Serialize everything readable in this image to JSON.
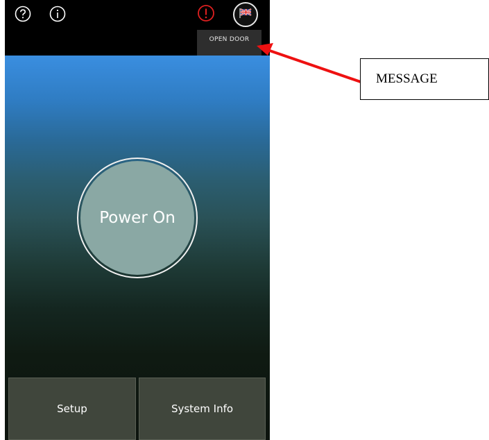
{
  "statusbar": {
    "icons": [
      "help-icon",
      "info-icon",
      "alert-icon",
      "uk-flag-icon"
    ],
    "alert_color": "#e02020"
  },
  "popup": {
    "label": "OPEN DOOR"
  },
  "main": {
    "power_label": "Power On"
  },
  "buttons": {
    "setup": "Setup",
    "system_info": "System Info"
  },
  "annotation": {
    "label": "MESSAGE",
    "arrow_color": "#ee1111"
  }
}
